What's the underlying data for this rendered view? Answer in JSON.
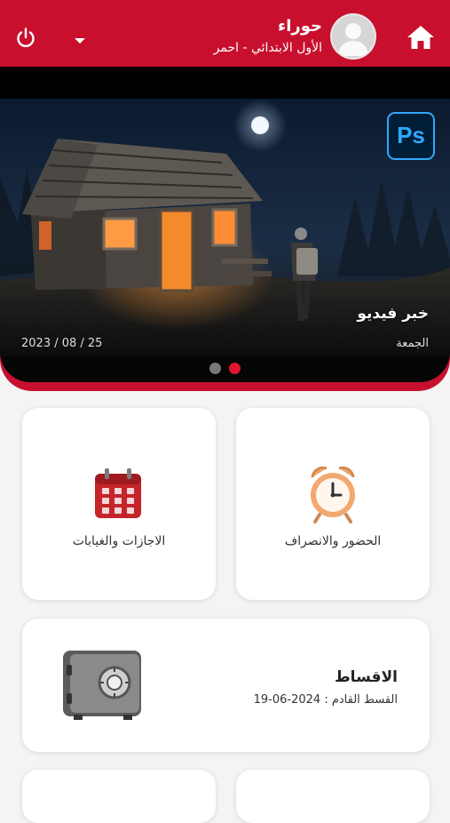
{
  "header": {
    "user_name": "حوراء",
    "user_class": "الأول الابتدائي - احمر",
    "icons": [
      "home-icon",
      "avatar-icon",
      "chevron-down-icon",
      "power-icon"
    ],
    "accent_color": "#c8102e"
  },
  "banner": {
    "title": "خبر فيديو",
    "day": "الجمعة",
    "date": "2023 / 08 / 25",
    "badge": "Ps",
    "active_slide": 2,
    "slide_count": 2
  },
  "cards": {
    "attendance_label": "الحضور والانصراف",
    "leaves_label": "الاجازات والغيابات"
  },
  "installments": {
    "title": "الاقساط",
    "next": "القسط القادم : 2024-06-19"
  }
}
